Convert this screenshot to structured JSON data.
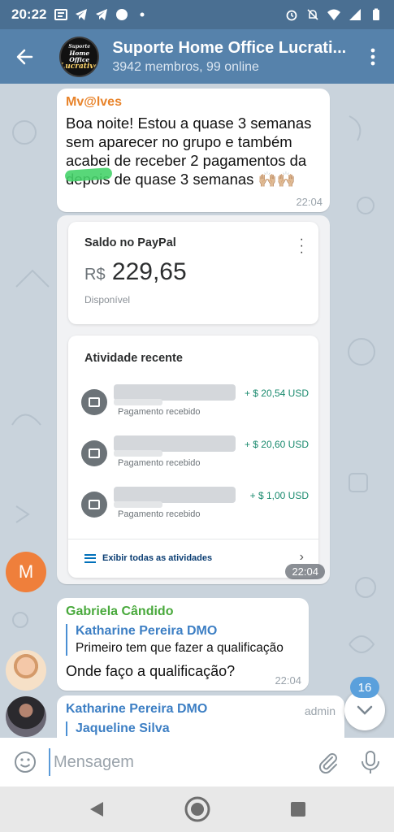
{
  "status_bar": {
    "time": "20:22"
  },
  "header": {
    "title": "Suporte Home Office Lucrati...",
    "subtitle": "3942 membros, 99 online",
    "avatar_lines": [
      "Suporte",
      "Home Office",
      "Lucrativo"
    ]
  },
  "messages": {
    "m1": {
      "sender": "Mv@lves",
      "sender_color": "#e8832a",
      "text": "Boa noite! Estou a quase 3 semanas sem aparecer no grupo e também acabei de receber 2 pagamentos da  depois de quase 3 semanas 🙌🏼🙌🏼",
      "time": "22:04"
    },
    "paypal": {
      "balance_title": "Saldo no PayPal",
      "currency": "R$",
      "amount": "229,65",
      "available": "Disponível",
      "activity_title": "Atividade recente",
      "rows": [
        {
          "label": "Pagamento recebido",
          "amount": "+ $ 20,54 USD"
        },
        {
          "label": "Pagamento recebido",
          "amount": "+ $ 20,60 USD"
        },
        {
          "label": "Pagamento recebido",
          "amount": "+ $ 1,00 USD"
        }
      ],
      "view_all": "Exibir todas as atividades",
      "time": "22:04"
    },
    "avatar_m_letter": "M",
    "m2": {
      "sender": "Gabriela Cândido",
      "sender_color": "#49a93c",
      "reply_name": "Katharine Pereira DMO",
      "reply_text": "Primeiro tem que fazer a qualificação",
      "text": "Onde faço a qualificação?",
      "time": "22:04"
    },
    "m3": {
      "sender": "Katharine Pereira DMO",
      "sender_color": "#3d7fc4",
      "role": "admin",
      "reply_name": "Jaqueline Silva"
    }
  },
  "unread_count": "16",
  "composer": {
    "placeholder": "Mensagem"
  },
  "icons": [
    "back-arrow-icon",
    "more-vert-icon",
    "emoji-icon",
    "attach-icon",
    "mic-icon",
    "chevron-down-icon",
    "nav-back-icon",
    "nav-home-icon",
    "nav-recents-icon"
  ]
}
